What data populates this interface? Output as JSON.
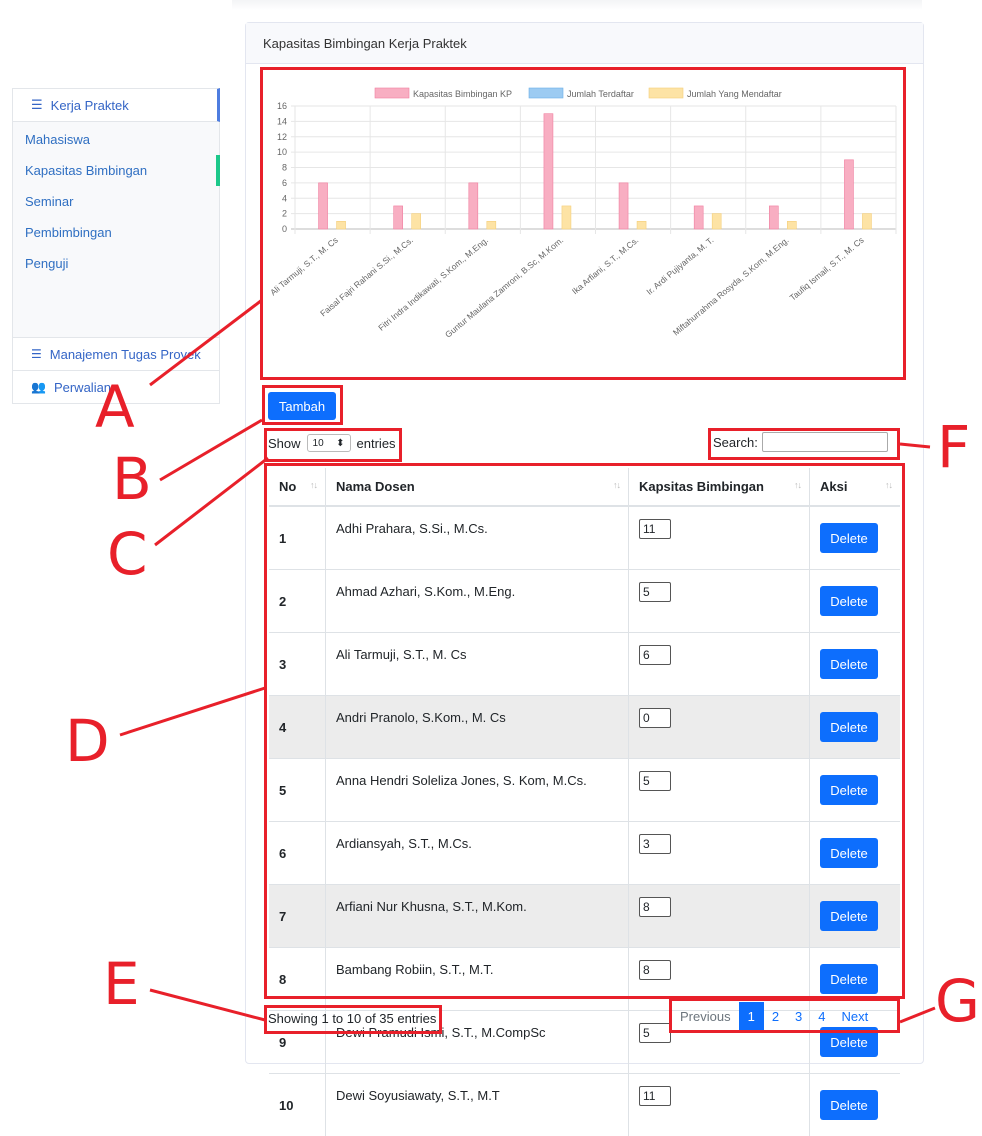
{
  "sidebar": {
    "main_label": "Kerja Praktek",
    "items": [
      "Mahasiswa",
      "Kapasitas Bimbingan",
      "Seminar",
      "Pembimbingan",
      "Penguji"
    ],
    "active_item": "Kapasitas Bimbingan",
    "extra": [
      "Manajemen Tugas Proyek",
      "Perwalian"
    ]
  },
  "card": {
    "title": "Kapasitas Bimbingan Kerja Praktek"
  },
  "chart_data": {
    "type": "bar",
    "categories": [
      "Ali Tarmuji, S.T., M. Cs",
      "Faisal Fajri Rahani S.Si., M.Cs.",
      "Fitri Indra Indikawati, S.Kom., M.Eng.",
      "Guntur Maulana Zamroni, B.Sc, M.Kom.",
      "Ika Arfiani, S.T., M.Cs.",
      "Ir. Ardi Pujiyanta, M. T.",
      "Miftahurrahma Rosyda, S.Kom, M.Eng.",
      "Taufiq Ismail, S.T., M. Cs"
    ],
    "series": [
      {
        "name": "Kapasitas Bimbingan KP",
        "color": "#f8aec2",
        "values": [
          6,
          3,
          6,
          15,
          6,
          3,
          3,
          9
        ]
      },
      {
        "name": "Jumlah Terdaftar",
        "color": "#9ccbf2",
        "values": [
          0,
          0,
          0,
          0,
          0,
          0,
          0,
          0
        ]
      },
      {
        "name": "Jumlah Yang Mendaftar",
        "color": "#fde3a5",
        "values": [
          1,
          2,
          1,
          3,
          1,
          2,
          1,
          2
        ]
      }
    ],
    "yticks": [
      0,
      2,
      4,
      6,
      8,
      10,
      12,
      14,
      16
    ],
    "ylim": [
      0,
      16
    ],
    "legend": "top",
    "grid": true
  },
  "controls": {
    "add_label": "Tambah",
    "show_label": "Show",
    "length_value": "10",
    "entries_label": "entries",
    "search_label": "Search:",
    "search_value": ""
  },
  "table": {
    "headers": [
      "No",
      "Nama Dosen",
      "Kapsitas Bimbingan",
      "Aksi"
    ],
    "delete_label": "Delete",
    "rows": [
      {
        "no": "1",
        "nama": "Adhi Prahara, S.Si., M.Cs.",
        "kapasitas": "11"
      },
      {
        "no": "2",
        "nama": "Ahmad Azhari, S.Kom., M.Eng.",
        "kapasitas": "5"
      },
      {
        "no": "3",
        "nama": "Ali Tarmuji, S.T., M. Cs",
        "kapasitas": "6"
      },
      {
        "no": "4",
        "nama": "Andri Pranolo, S.Kom., M. Cs",
        "kapasitas": "0"
      },
      {
        "no": "5",
        "nama": "Anna Hendri Soleliza Jones, S. Kom, M.Cs.",
        "kapasitas": "5"
      },
      {
        "no": "6",
        "nama": "Ardiansyah, S.T., M.Cs.",
        "kapasitas": "3"
      },
      {
        "no": "7",
        "nama": "Arfiani Nur Khusna, S.T., M.Kom.",
        "kapasitas": "8"
      },
      {
        "no": "8",
        "nama": "Bambang Robiin, S.T., M.T.",
        "kapasitas": "8"
      },
      {
        "no": "9",
        "nama": "Dewi Pramudi Ismi, S.T., M.CompSc",
        "kapasitas": "5"
      },
      {
        "no": "10",
        "nama": "Dewi Soyusiawaty, S.T., M.T",
        "kapasitas": "11"
      }
    ]
  },
  "footer": {
    "info": "Showing 1 to 10 of 35 entries",
    "prev": "Previous",
    "pages": [
      "1",
      "2",
      "3",
      "4"
    ],
    "next": "Next"
  },
  "annotations": [
    "A",
    "B",
    "C",
    "D",
    "E",
    "F",
    "G"
  ]
}
